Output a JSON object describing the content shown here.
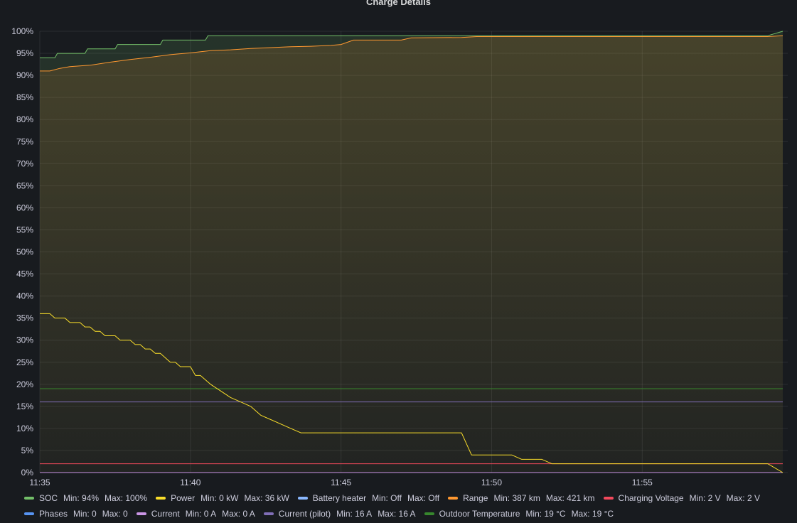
{
  "panel": {
    "title": "Charge Details"
  },
  "chart_data": {
    "type": "line",
    "title": "Charge Details",
    "xlabel": "",
    "ylabel": "",
    "xlim": [
      "11:35",
      "11:59:40"
    ],
    "ylim": [
      0,
      100
    ],
    "y_ticks": [
      "0%",
      "5%",
      "10%",
      "15%",
      "20%",
      "25%",
      "30%",
      "35%",
      "40%",
      "45%",
      "50%",
      "55%",
      "60%",
      "65%",
      "70%",
      "75%",
      "80%",
      "85%",
      "90%",
      "95%",
      "100%"
    ],
    "x_ticks": [
      "11:35",
      "11:40",
      "11:45",
      "11:50",
      "11:55"
    ],
    "grid": true,
    "legend_position": "bottom",
    "series": [
      {
        "name": "SOC",
        "color": "#73bf69",
        "fill": true,
        "step": true,
        "points": [
          [
            "11:35:00",
            94
          ],
          [
            "11:35:30",
            94
          ],
          [
            "11:35:35",
            95
          ],
          [
            "11:36:30",
            95
          ],
          [
            "11:36:35",
            96
          ],
          [
            "11:37:30",
            96
          ],
          [
            "11:37:35",
            97
          ],
          [
            "11:39:00",
            97
          ],
          [
            "11:39:05",
            98
          ],
          [
            "11:40:30",
            98
          ],
          [
            "11:40:35",
            99
          ],
          [
            "11:59:10",
            99
          ],
          [
            "11:59:40",
            100
          ]
        ]
      },
      {
        "name": "Range",
        "color": "#ff9830",
        "fill": true,
        "step": false,
        "points": [
          [
            "11:35:00",
            91.0
          ],
          [
            "11:35:20",
            91.0
          ],
          [
            "11:35:40",
            91.6
          ],
          [
            "11:36:00",
            92.0
          ],
          [
            "11:36:40",
            92.3
          ],
          [
            "11:37:20",
            93.0
          ],
          [
            "11:38:00",
            93.6
          ],
          [
            "11:38:40",
            94.1
          ],
          [
            "11:39:20",
            94.7
          ],
          [
            "11:40:00",
            95.1
          ],
          [
            "11:40:40",
            95.6
          ],
          [
            "11:41:20",
            95.8
          ],
          [
            "11:42:00",
            96.1
          ],
          [
            "11:42:40",
            96.3
          ],
          [
            "11:43:20",
            96.5
          ],
          [
            "11:44:00",
            96.6
          ],
          [
            "11:44:40",
            96.8
          ],
          [
            "11:45:00",
            97.0
          ],
          [
            "11:45:25",
            98.0
          ],
          [
            "11:47:00",
            98.0
          ],
          [
            "11:47:20",
            98.5
          ],
          [
            "11:49:00",
            98.6
          ],
          [
            "11:49:30",
            98.8
          ],
          [
            "11:59:10",
            98.8
          ],
          [
            "11:59:40",
            99.0
          ]
        ]
      },
      {
        "name": "Power",
        "color": "#fade2a",
        "fill": false,
        "step": false,
        "points": [
          [
            "11:35:00",
            36
          ],
          [
            "11:35:20",
            36
          ],
          [
            "11:35:30",
            35
          ],
          [
            "11:35:50",
            35
          ],
          [
            "11:36:00",
            34
          ],
          [
            "11:36:20",
            34
          ],
          [
            "11:36:30",
            33
          ],
          [
            "11:36:40",
            33
          ],
          [
            "11:36:50",
            32
          ],
          [
            "11:37:00",
            32
          ],
          [
            "11:37:10",
            31
          ],
          [
            "11:37:30",
            31
          ],
          [
            "11:37:40",
            30
          ],
          [
            "11:38:00",
            30
          ],
          [
            "11:38:10",
            29
          ],
          [
            "11:38:20",
            29
          ],
          [
            "11:38:30",
            28
          ],
          [
            "11:38:40",
            28
          ],
          [
            "11:38:50",
            27
          ],
          [
            "11:39:00",
            27
          ],
          [
            "11:39:20",
            25
          ],
          [
            "11:39:30",
            25
          ],
          [
            "11:39:40",
            24
          ],
          [
            "11:40:00",
            24
          ],
          [
            "11:40:10",
            22
          ],
          [
            "11:40:20",
            22
          ],
          [
            "11:40:40",
            20
          ],
          [
            "11:41:00",
            18.5
          ],
          [
            "11:41:20",
            17
          ],
          [
            "11:41:40",
            16
          ],
          [
            "11:42:00",
            15
          ],
          [
            "11:42:20",
            13
          ],
          [
            "11:42:40",
            12
          ],
          [
            "11:43:20",
            10
          ],
          [
            "11:43:40",
            9
          ],
          [
            "11:49:00",
            9
          ],
          [
            "11:49:20",
            4
          ],
          [
            "11:50:40",
            4
          ],
          [
            "11:51:00",
            3
          ],
          [
            "11:51:40",
            3
          ],
          [
            "11:52:00",
            2
          ],
          [
            "11:59:10",
            2
          ],
          [
            "11:59:40",
            0
          ]
        ]
      },
      {
        "name": "Battery heater",
        "color": "#8ab8ff",
        "fill": false,
        "step": true,
        "points": [
          [
            "11:35:00",
            0
          ],
          [
            "11:59:40",
            0
          ]
        ]
      },
      {
        "name": "Charging Voltage",
        "color": "#f2495c",
        "fill": false,
        "step": true,
        "points": [
          [
            "11:35:00",
            2
          ],
          [
            "11:59:40",
            2
          ]
        ]
      },
      {
        "name": "Phases",
        "color": "#5794f2",
        "fill": false,
        "step": true,
        "points": [
          [
            "11:35:00",
            0
          ],
          [
            "11:59:40",
            0
          ]
        ]
      },
      {
        "name": "Current",
        "color": "#ca95e5",
        "fill": false,
        "step": true,
        "points": [
          [
            "11:35:00",
            0
          ],
          [
            "11:59:40",
            0
          ]
        ]
      },
      {
        "name": "Current (pilot)",
        "color": "#806eb7",
        "fill": false,
        "step": true,
        "points": [
          [
            "11:35:00",
            16
          ],
          [
            "11:59:40",
            16
          ]
        ]
      },
      {
        "name": "Outdoor Temperature",
        "color": "#37872d",
        "fill": false,
        "step": true,
        "points": [
          [
            "11:35:00",
            19
          ],
          [
            "11:59:40",
            19
          ]
        ]
      }
    ]
  },
  "legend": {
    "rows": [
      [
        {
          "name": "SOC",
          "color": "#73bf69",
          "min": "Min: 94%",
          "max": "Max: 100%"
        },
        {
          "name": "Power",
          "color": "#fade2a",
          "min": "Min: 0 kW",
          "max": "Max: 36 kW"
        },
        {
          "name": "Battery heater",
          "color": "#8ab8ff",
          "min": "Min: Off",
          "max": "Max: Off"
        },
        {
          "name": "Range",
          "color": "#ff9830",
          "min": "Min: 387 km",
          "max": "Max: 421 km"
        },
        {
          "name": "Charging Voltage",
          "color": "#f2495c",
          "min": "Min: 2 V",
          "max": "Max: 2 V"
        }
      ],
      [
        {
          "name": "Phases",
          "color": "#5794f2",
          "min": "Min: 0",
          "max": "Max: 0"
        },
        {
          "name": "Current",
          "color": "#ca95e5",
          "min": "Min: 0 A",
          "max": "Max: 0 A"
        },
        {
          "name": "Current (pilot)",
          "color": "#806eb7",
          "min": "Min: 16 A",
          "max": "Max: 16 A"
        },
        {
          "name": "Outdoor Temperature",
          "color": "#37872d",
          "min": "Min: 19 °C",
          "max": "Max: 19 °C"
        }
      ]
    ]
  }
}
